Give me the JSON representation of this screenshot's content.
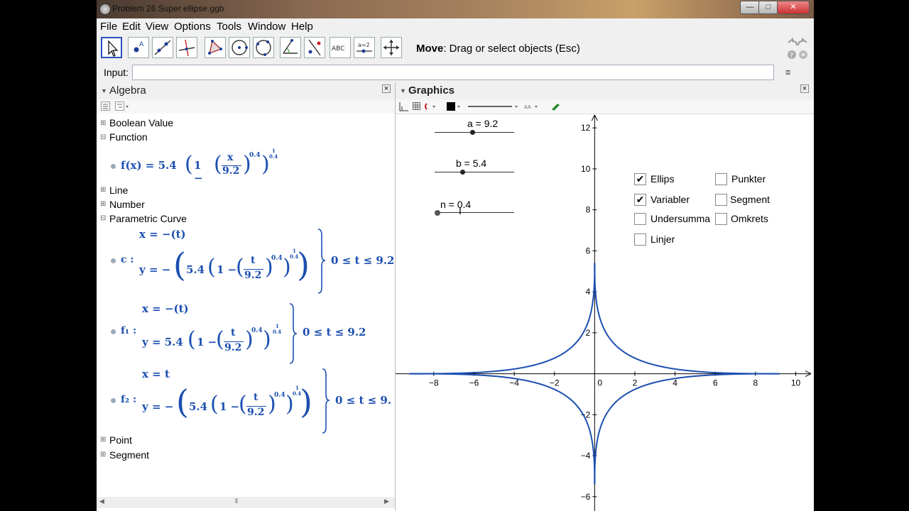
{
  "window": {
    "title": "Problem 26 Super ellipse.ggb",
    "controls": {
      "minimize": "—",
      "maximize": "□",
      "close": "✕"
    }
  },
  "menu": [
    "File",
    "Edit",
    "View",
    "Options",
    "Tools",
    "Window",
    "Help"
  ],
  "toolbar": {
    "tools": [
      "move-tool",
      "point-tool",
      "line-tool",
      "perpendicular-line-tool",
      "polygon-tool",
      "circle-tool",
      "circle-three-points-tool",
      "angle-tool",
      "reflect-tool",
      "text-tool",
      "slider-tool",
      "move-graphics-view-tool"
    ],
    "help_bold": "Move",
    "help_text": ": Drag or select objects (Esc)"
  },
  "input": {
    "label": "Input:",
    "value": ""
  },
  "algebra": {
    "title": "Algebra",
    "categories": {
      "boolean": "Boolean Value",
      "function": "Function",
      "line": "Line",
      "number": "Number",
      "parametric": "Parametric Curve",
      "point": "Point",
      "segment": "Segment"
    },
    "f": {
      "lhs": "f(x) = 5.4",
      "num": "x",
      "den": "9.2",
      "exp1": "0.4",
      "exp2num": "1",
      "exp2den": "0.4"
    },
    "c": {
      "name": "c :",
      "x": "x = −(t)",
      "y_prefix": "y = −",
      "coef": "5.4",
      "num": "t",
      "den": "9.2",
      "exp1": "0.4",
      "exp2num": "1",
      "exp2den": "0.4",
      "range": "0 ≤ t ≤ 9.2"
    },
    "f1": {
      "name": "f₁ :",
      "x": "x = −(t)",
      "y_prefix": "y = 5.4",
      "num": "t",
      "den": "9.2",
      "exp1": "0.4",
      "exp2num": "1",
      "exp2den": "0.4",
      "range": "0 ≤ t ≤ 9.2"
    },
    "f2": {
      "name": "f₂ :",
      "x": "x = t",
      "y_prefix": "y = −",
      "coef": "5.4",
      "num": "t",
      "den": "9.2",
      "exp1": "0.4",
      "exp2num": "1",
      "exp2den": "0.4",
      "range": "0 ≤ t ≤ 9."
    }
  },
  "graphics": {
    "title": "Graphics",
    "sliders": [
      {
        "label": "a = 9.2",
        "value": 9.2
      },
      {
        "label": "b = 5.4",
        "value": 5.4
      },
      {
        "label": "n = 0.4",
        "value": 0.4
      }
    ],
    "checkboxes": [
      {
        "label": "Ellips",
        "checked": true
      },
      {
        "label": "Punkter",
        "checked": false
      },
      {
        "label": "Variabler",
        "checked": true
      },
      {
        "label": "Segment",
        "checked": false
      },
      {
        "label": "Undersumma",
        "checked": false
      },
      {
        "label": "Omkrets",
        "checked": false
      },
      {
        "label": "Linjer",
        "checked": false
      }
    ],
    "axes": {
      "x_ticks": [
        "−8",
        "−6",
        "−4",
        "−2",
        "0",
        "2",
        "4",
        "6",
        "8",
        "10"
      ],
      "y_ticks": [
        "12",
        "10",
        "8",
        "6",
        "4",
        "2",
        "0",
        "−2",
        "−4",
        "−6"
      ],
      "xlim": [
        -9.9,
        10.9
      ],
      "ylim": [
        -6.7,
        12.7
      ]
    },
    "curve_color": "#1c4fb0",
    "curve": {
      "a": 9.2,
      "b": 5.4,
      "n": 0.4
    }
  }
}
